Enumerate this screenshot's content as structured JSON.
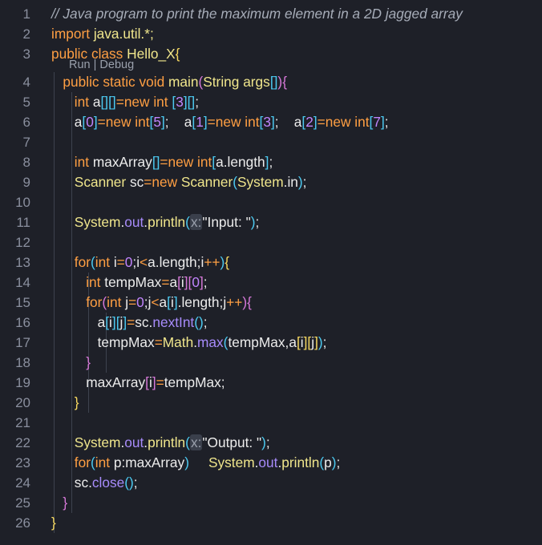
{
  "editor": {
    "codelens": "Run | Debug",
    "line_numbers": [
      "1",
      "2",
      "3",
      "4",
      "5",
      "6",
      "7",
      "8",
      "9",
      "10",
      "11",
      "12",
      "13",
      "14",
      "15",
      "16",
      "17",
      "18",
      "19",
      "20",
      "21",
      "22",
      "23",
      "24",
      "25",
      "26"
    ],
    "lines": [
      [
        {
          "t": "// Java program to print the maximum element in a 2D jagged array",
          "c": "cm"
        }
      ],
      [
        {
          "t": "import ",
          "c": "kw"
        },
        {
          "t": "java.util.*;",
          "c": "cls"
        }
      ],
      [
        {
          "t": "public class ",
          "c": "kw"
        },
        {
          "t": "Hello_X",
          "c": "cls"
        },
        {
          "t": "{",
          "c": "br"
        }
      ],
      [
        {
          "t": "   public static void ",
          "c": "kw"
        },
        {
          "t": "main",
          "c": "cls"
        },
        {
          "t": "(",
          "c": "br2"
        },
        {
          "t": "String ",
          "c": "cls"
        },
        {
          "t": "args",
          "c": "cls"
        },
        {
          "t": "[]",
          "c": "br3"
        },
        {
          "t": ")",
          "c": "br2"
        },
        {
          "t": "{",
          "c": "br2"
        }
      ],
      [
        {
          "t": "      int ",
          "c": "kw"
        },
        {
          "t": "a",
          "c": "id"
        },
        {
          "t": "[]",
          "c": "br3"
        },
        {
          "t": "[]",
          "c": "br3"
        },
        {
          "t": "=",
          "c": "kw"
        },
        {
          "t": "new int ",
          "c": "kw"
        },
        {
          "t": "[",
          "c": "br3"
        },
        {
          "t": "3",
          "c": "num"
        },
        {
          "t": "]",
          "c": "br3"
        },
        {
          "t": "[]",
          "c": "br3"
        },
        {
          "t": ";",
          "c": "pn"
        }
      ],
      [
        {
          "t": "      a",
          "c": "id"
        },
        {
          "t": "[",
          "c": "br3"
        },
        {
          "t": "0",
          "c": "num"
        },
        {
          "t": "]",
          "c": "br3"
        },
        {
          "t": "=",
          "c": "kw"
        },
        {
          "t": "new int",
          "c": "kw"
        },
        {
          "t": "[",
          "c": "br3"
        },
        {
          "t": "5",
          "c": "num"
        },
        {
          "t": "]",
          "c": "br3"
        },
        {
          "t": ";    ",
          "c": "pn"
        },
        {
          "t": "a",
          "c": "id"
        },
        {
          "t": "[",
          "c": "br3"
        },
        {
          "t": "1",
          "c": "num"
        },
        {
          "t": "]",
          "c": "br3"
        },
        {
          "t": "=",
          "c": "kw"
        },
        {
          "t": "new int",
          "c": "kw"
        },
        {
          "t": "[",
          "c": "br3"
        },
        {
          "t": "3",
          "c": "num"
        },
        {
          "t": "]",
          "c": "br3"
        },
        {
          "t": ";    ",
          "c": "pn"
        },
        {
          "t": "a",
          "c": "id"
        },
        {
          "t": "[",
          "c": "br3"
        },
        {
          "t": "2",
          "c": "num"
        },
        {
          "t": "]",
          "c": "br3"
        },
        {
          "t": "=",
          "c": "kw"
        },
        {
          "t": "new int",
          "c": "kw"
        },
        {
          "t": "[",
          "c": "br3"
        },
        {
          "t": "7",
          "c": "num"
        },
        {
          "t": "]",
          "c": "br3"
        },
        {
          "t": ";",
          "c": "pn"
        }
      ],
      [],
      [
        {
          "t": "      int ",
          "c": "kw"
        },
        {
          "t": "maxArray",
          "c": "id"
        },
        {
          "t": "[]",
          "c": "br3"
        },
        {
          "t": "=",
          "c": "kw"
        },
        {
          "t": "new int",
          "c": "kw"
        },
        {
          "t": "[",
          "c": "br3"
        },
        {
          "t": "a",
          "c": "id"
        },
        {
          "t": ".",
          "c": "pn"
        },
        {
          "t": "length",
          "c": "id"
        },
        {
          "t": "]",
          "c": "br3"
        },
        {
          "t": ";",
          "c": "pn"
        }
      ],
      [
        {
          "t": "      Scanner ",
          "c": "cls"
        },
        {
          "t": "sc",
          "c": "id"
        },
        {
          "t": "=",
          "c": "kw"
        },
        {
          "t": "new ",
          "c": "kw"
        },
        {
          "t": "Scanner",
          "c": "cls"
        },
        {
          "t": "(",
          "c": "br3"
        },
        {
          "t": "System",
          "c": "cls"
        },
        {
          "t": ".",
          "c": "pn"
        },
        {
          "t": "in",
          "c": "id"
        },
        {
          "t": ")",
          "c": "br3"
        },
        {
          "t": ";",
          "c": "pn"
        }
      ],
      [],
      [
        {
          "t": "      System",
          "c": "cls"
        },
        {
          "t": ".",
          "c": "pn"
        },
        {
          "t": "out",
          "c": "fn"
        },
        {
          "t": ".",
          "c": "pn"
        },
        {
          "t": "println",
          "c": "cls"
        },
        {
          "t": "(",
          "c": "br3"
        },
        {
          "t": "x:",
          "c": "hint"
        },
        {
          "t": "\"Input: \"",
          "c": "str"
        },
        {
          "t": ")",
          "c": "br3"
        },
        {
          "t": ";",
          "c": "pn"
        }
      ],
      [],
      [
        {
          "t": "      for",
          "c": "kw"
        },
        {
          "t": "(",
          "c": "br3"
        },
        {
          "t": "int ",
          "c": "kw"
        },
        {
          "t": "i",
          "c": "id"
        },
        {
          "t": "=",
          "c": "kw"
        },
        {
          "t": "0",
          "c": "num"
        },
        {
          "t": ";",
          "c": "pn"
        },
        {
          "t": "i",
          "c": "id"
        },
        {
          "t": "<",
          "c": "kw"
        },
        {
          "t": "a",
          "c": "id"
        },
        {
          "t": ".",
          "c": "pn"
        },
        {
          "t": "length",
          "c": "id"
        },
        {
          "t": ";",
          "c": "pn"
        },
        {
          "t": "i",
          "c": "id"
        },
        {
          "t": "++",
          "c": "kw"
        },
        {
          "t": ")",
          "c": "br3"
        },
        {
          "t": "{",
          "c": "br"
        }
      ],
      [
        {
          "t": "         int ",
          "c": "kw"
        },
        {
          "t": "tempMax",
          "c": "id"
        },
        {
          "t": "=",
          "c": "kw"
        },
        {
          "t": "a",
          "c": "id"
        },
        {
          "t": "[",
          "c": "br2"
        },
        {
          "t": "i",
          "c": "id"
        },
        {
          "t": "]",
          "c": "br2"
        },
        {
          "t": "[",
          "c": "br2"
        },
        {
          "t": "0",
          "c": "num"
        },
        {
          "t": "]",
          "c": "br2"
        },
        {
          "t": ";",
          "c": "pn"
        }
      ],
      [
        {
          "t": "         for",
          "c": "kw"
        },
        {
          "t": "(",
          "c": "br2"
        },
        {
          "t": "int ",
          "c": "kw"
        },
        {
          "t": "j",
          "c": "id"
        },
        {
          "t": "=",
          "c": "kw"
        },
        {
          "t": "0",
          "c": "num"
        },
        {
          "t": ";",
          "c": "pn"
        },
        {
          "t": "j",
          "c": "id"
        },
        {
          "t": "<",
          "c": "kw"
        },
        {
          "t": "a",
          "c": "id"
        },
        {
          "t": "[",
          "c": "br3"
        },
        {
          "t": "i",
          "c": "id"
        },
        {
          "t": "]",
          "c": "br3"
        },
        {
          "t": ".",
          "c": "pn"
        },
        {
          "t": "length",
          "c": "id"
        },
        {
          "t": ";",
          "c": "pn"
        },
        {
          "t": "j",
          "c": "id"
        },
        {
          "t": "++",
          "c": "kw"
        },
        {
          "t": ")",
          "c": "br2"
        },
        {
          "t": "{",
          "c": "br2"
        }
      ],
      [
        {
          "t": "            a",
          "c": "id"
        },
        {
          "t": "[",
          "c": "br3"
        },
        {
          "t": "i",
          "c": "id"
        },
        {
          "t": "]",
          "c": "br3"
        },
        {
          "t": "[",
          "c": "br3"
        },
        {
          "t": "j",
          "c": "id"
        },
        {
          "t": "]",
          "c": "br3"
        },
        {
          "t": "=",
          "c": "kw"
        },
        {
          "t": "sc",
          "c": "id"
        },
        {
          "t": ".",
          "c": "pn"
        },
        {
          "t": "nextInt",
          "c": "fn"
        },
        {
          "t": "()",
          "c": "br3"
        },
        {
          "t": ";",
          "c": "pn"
        }
      ],
      [
        {
          "t": "            tempMax",
          "c": "id"
        },
        {
          "t": "=",
          "c": "kw"
        },
        {
          "t": "Math",
          "c": "cls"
        },
        {
          "t": ".",
          "c": "pn"
        },
        {
          "t": "max",
          "c": "fn"
        },
        {
          "t": "(",
          "c": "br3"
        },
        {
          "t": "tempMax",
          "c": "id"
        },
        {
          "t": ",",
          "c": "pn"
        },
        {
          "t": "a",
          "c": "id"
        },
        {
          "t": "[",
          "c": "br"
        },
        {
          "t": "i",
          "c": "id"
        },
        {
          "t": "]",
          "c": "br"
        },
        {
          "t": "[",
          "c": "br"
        },
        {
          "t": "j",
          "c": "id"
        },
        {
          "t": "]",
          "c": "br"
        },
        {
          "t": ")",
          "c": "br3"
        },
        {
          "t": ";",
          "c": "pn"
        }
      ],
      [
        {
          "t": "         }",
          "c": "br2"
        }
      ],
      [
        {
          "t": "         maxArray",
          "c": "id"
        },
        {
          "t": "[",
          "c": "br2"
        },
        {
          "t": "i",
          "c": "id"
        },
        {
          "t": "]",
          "c": "br2"
        },
        {
          "t": "=",
          "c": "kw"
        },
        {
          "t": "tempMax",
          "c": "id"
        },
        {
          "t": ";",
          "c": "pn"
        }
      ],
      [
        {
          "t": "      }",
          "c": "br"
        }
      ],
      [],
      [
        {
          "t": "      System",
          "c": "cls"
        },
        {
          "t": ".",
          "c": "pn"
        },
        {
          "t": "out",
          "c": "fn"
        },
        {
          "t": ".",
          "c": "pn"
        },
        {
          "t": "println",
          "c": "cls"
        },
        {
          "t": "(",
          "c": "br3"
        },
        {
          "t": "x:",
          "c": "hint"
        },
        {
          "t": "\"Output: \"",
          "c": "str"
        },
        {
          "t": ")",
          "c": "br3"
        },
        {
          "t": ";",
          "c": "pn"
        }
      ],
      [
        {
          "t": "      for",
          "c": "kw"
        },
        {
          "t": "(",
          "c": "br3"
        },
        {
          "t": "int ",
          "c": "kw"
        },
        {
          "t": "p",
          "c": "id"
        },
        {
          "t": ":",
          "c": "pn"
        },
        {
          "t": "maxArray",
          "c": "id"
        },
        {
          "t": ")",
          "c": "br3"
        },
        {
          "t": "     ",
          "c": "pn"
        },
        {
          "t": "System",
          "c": "cls"
        },
        {
          "t": ".",
          "c": "pn"
        },
        {
          "t": "out",
          "c": "fn"
        },
        {
          "t": ".",
          "c": "pn"
        },
        {
          "t": "println",
          "c": "cls"
        },
        {
          "t": "(",
          "c": "br3"
        },
        {
          "t": "p",
          "c": "id"
        },
        {
          "t": ")",
          "c": "br3"
        },
        {
          "t": ";",
          "c": "pn"
        }
      ],
      [
        {
          "t": "      sc",
          "c": "id"
        },
        {
          "t": ".",
          "c": "pn"
        },
        {
          "t": "close",
          "c": "fn"
        },
        {
          "t": "()",
          "c": "br3"
        },
        {
          "t": ";",
          "c": "pn"
        }
      ],
      [
        {
          "t": "   }",
          "c": "br2"
        }
      ],
      [
        {
          "t": "}",
          "c": "br"
        }
      ]
    ]
  }
}
